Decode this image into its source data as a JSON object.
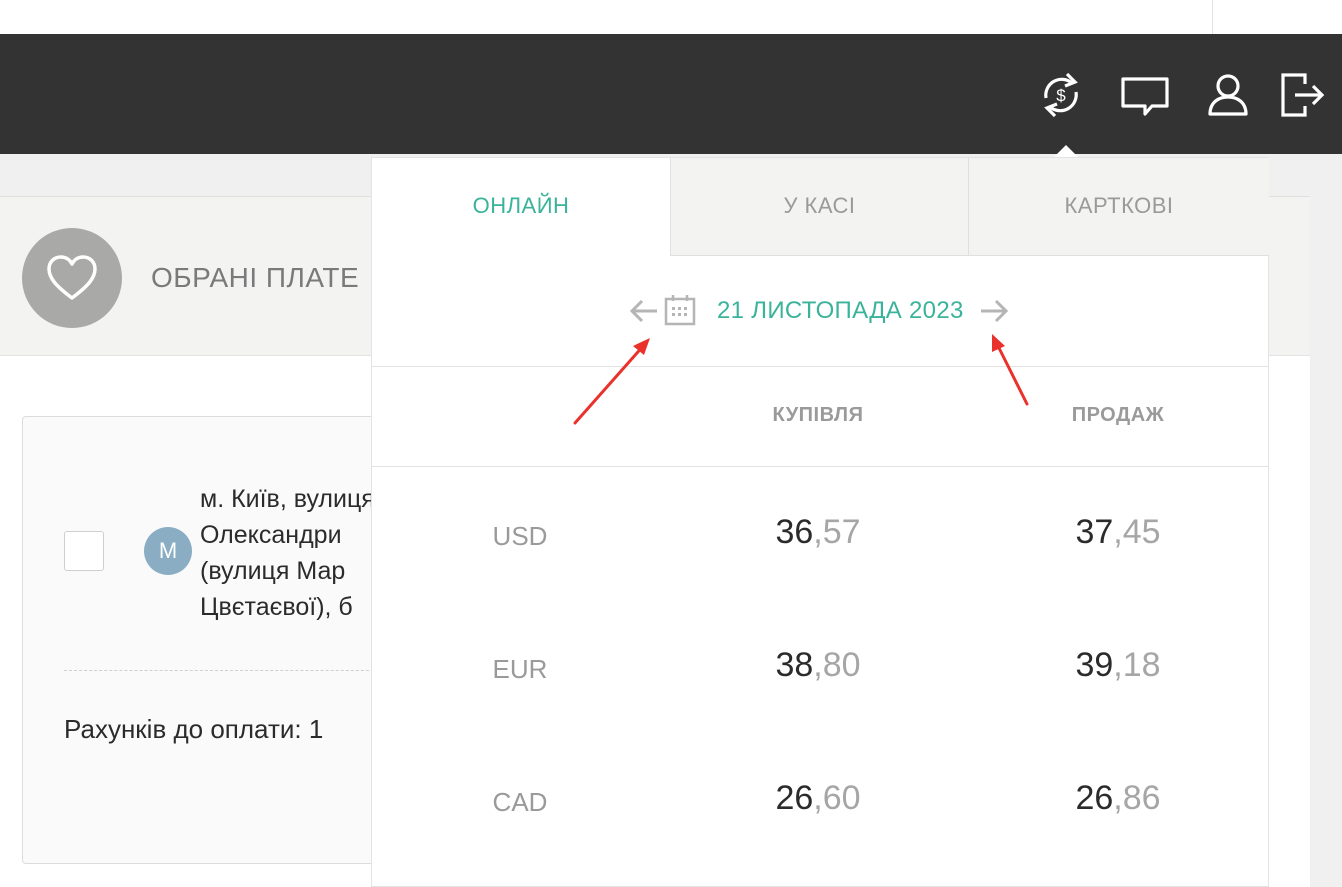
{
  "header": {
    "icons": [
      "currency-exchange-icon",
      "chat-icon",
      "user-icon",
      "logout-icon"
    ]
  },
  "favorites": {
    "title": "ОБРАНІ ПЛАТЕ"
  },
  "card": {
    "avatar_letter": "М",
    "address": "м. Київ, вулиця\nОлександри\n(вулиця Мар\nЦвєтаєвої), б",
    "bills_label": "Рахунків до оплати: 1"
  },
  "rates_popup": {
    "tabs": [
      {
        "label": "ОНЛАЙН",
        "active": true
      },
      {
        "label": "У КАСІ",
        "active": false
      },
      {
        "label": "КАРТКОВІ",
        "active": false
      }
    ],
    "date": "21 ЛИСТОПАДА 2023",
    "columns": {
      "buy": "КУПІВЛЯ",
      "sell": "ПРОДАЖ"
    },
    "rates": [
      {
        "currency": "USD",
        "buy_int": "36",
        "buy_frac": ",57",
        "sell_int": "37",
        "sell_frac": ",45"
      },
      {
        "currency": "EUR",
        "buy_int": "38",
        "buy_frac": ",80",
        "sell_int": "39",
        "sell_frac": ",18"
      },
      {
        "currency": "CAD",
        "buy_int": "26",
        "buy_frac": ",60",
        "sell_int": "26",
        "sell_frac": ",86"
      }
    ]
  },
  "colors": {
    "accent": "#3bb39b",
    "navbar": "#333333",
    "annotation_arrow": "#e8322b"
  }
}
